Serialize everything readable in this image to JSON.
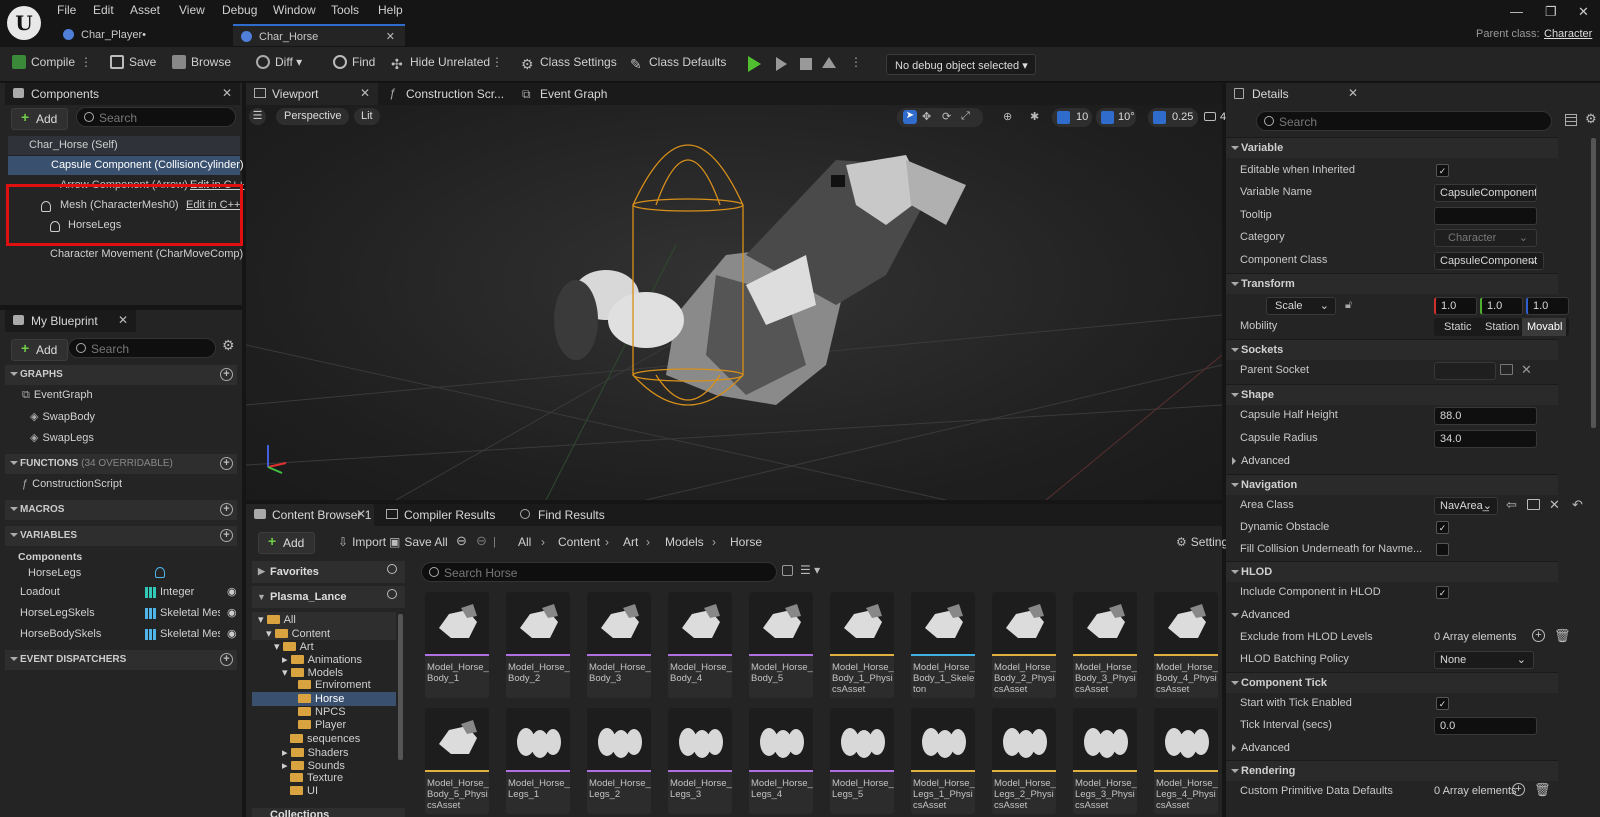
{
  "menu": [
    "File",
    "Edit",
    "Asset",
    "View",
    "Debug",
    "Window",
    "Tools",
    "Help"
  ],
  "tabs": [
    "Char_Player•",
    "Char_Horse"
  ],
  "parent_class": {
    "label": "Parent class:",
    "value": "Character"
  },
  "toolbar": {
    "compile": "Compile",
    "save": "Save",
    "browse": "Browse",
    "diff": "Diff",
    "find": "Find",
    "hide_unrelated": "Hide Unrelated",
    "class_settings": "Class Settings",
    "class_defaults": "Class Defaults",
    "debug": "No debug object selected"
  },
  "components": {
    "title": "Components",
    "add": "Add",
    "search": "Search",
    "items": [
      "Char_Horse (Self)",
      "Capsule Component (CollisionCylinder)",
      "Arrow Component (Arrow)",
      "Edit in C++",
      "Mesh (CharacterMesh0)",
      "Edit in C++",
      "HorseLegs",
      "Character Movement (CharMoveComp)"
    ]
  },
  "my_blueprint": {
    "title": "My Blueprint",
    "add": "Add",
    "search": "Search",
    "graphs": "GRAPHS",
    "event_graph": "EventGraph",
    "swap_body": "SwapBody",
    "swap_legs": "SwapLegs",
    "functions": "FUNCTIONS",
    "functions_count": "(34 OVERRIDABLE)",
    "construction_script": "ConstructionScript",
    "macros": "MACROS",
    "variables": "VARIABLES",
    "components_cat": "Components",
    "vars": [
      {
        "name": "HorseLegs",
        "type": ""
      },
      {
        "name": "Loadout",
        "type": "Integer"
      },
      {
        "name": "HorseLegSkels",
        "type": "Skeletal Mes"
      },
      {
        "name": "HorseBodySkels",
        "type": "Skeletal Mes"
      }
    ],
    "event_dispatchers": "EVENT DISPATCHERS"
  },
  "viewport": {
    "tabs": [
      "Viewport",
      "Construction Scr...",
      "Event Graph"
    ],
    "perspective": "Perspective",
    "lit": "Lit",
    "grid": "10",
    "angle": "10°",
    "scale": "0.25",
    "cam": "4"
  },
  "content": {
    "tabs": [
      "Content Browser 1",
      "Compiler Results",
      "Find Results"
    ],
    "add": "Add",
    "import": "Import",
    "save_all": "Save All",
    "path": [
      "All",
      "Content",
      "Art",
      "Models",
      "Horse"
    ],
    "settings": "Settings",
    "favorites": "Favorites",
    "project": "Plasma_Lance",
    "search": "Search Horse",
    "collections": "Collections",
    "tree": [
      "All",
      "Content",
      "Art",
      "Animations",
      "Models",
      "Enviroment",
      "Horse",
      "NPCS",
      "Player",
      "sequences",
      "Shaders",
      "Sounds",
      "Texture",
      "UI"
    ],
    "assets": [
      "Model_Horse_Body_1",
      "Model_Horse_Body_2",
      "Model_Horse_Body_3",
      "Model_Horse_Body_4",
      "Model_Horse_Body_5",
      "Model_Horse_Body_1_PhysicsAsset",
      "Model_Horse_Body_1_Skeleton",
      "Model_Horse_Body_2_PhysicsAsset",
      "Model_Horse_Body_3_PhysicsAsset",
      "Model_Horse_Body_4_PhysicsAsset",
      "Model_Horse_Body_5_PhysicsAsset",
      "Model_Horse_Legs_1",
      "Model_Horse_Legs_2",
      "Model_Horse_Legs_3",
      "Model_Horse_Legs_4",
      "Model_Horse_Legs_5",
      "Model_Horse_Legs_1_PhysicsAsset",
      "Model_Horse_Legs_2_PhysicsAsset",
      "Model_Horse_Legs_3_PhysicsAsset",
      "Model_Horse_Legs_4_PhysicsAsset"
    ]
  },
  "details": {
    "title": "Details",
    "search": "Search",
    "variable": "Variable",
    "editable": "Editable when Inherited",
    "var_name_l": "Variable Name",
    "var_name": "CapsuleComponent",
    "tooltip": "Tooltip",
    "category_l": "Category",
    "category": "Character",
    "comp_class_l": "Component Class",
    "comp_class": "CapsuleComponent",
    "transform": "Transform",
    "scale": "Scale",
    "sx": "1.0",
    "sy": "1.0",
    "sz": "1.0",
    "mobility": "Mobility",
    "static": "Static",
    "station": "Station",
    "movable": "Movabl",
    "sockets": "Sockets",
    "parent_socket": "Parent Socket",
    "shape": "Shape",
    "half_height_l": "Capsule Half Height",
    "half_height": "88.0",
    "radius_l": "Capsule Radius",
    "radius": "34.0",
    "advanced": "Advanced",
    "navigation": "Navigation",
    "area_class_l": "Area Class",
    "area_class": "NavArea_",
    "dynamic_obstacle": "Dynamic Obstacle",
    "fill_collision": "Fill Collision Underneath for Navme...",
    "hlod": "HLOD",
    "include_hlod": "Include Component in HLOD",
    "exclude_hlod": "Exclude from HLOD Levels",
    "array0": "0 Array elements",
    "hlod_batching": "HLOD Batching Policy",
    "none": "None",
    "component_tick": "Component Tick",
    "start_tick": "Start with Tick Enabled",
    "tick_interval_l": "Tick Interval (secs)",
    "tick_interval": "0.0",
    "rendering": "Rendering",
    "custom_prim": "Custom Primitive Data Defaults"
  }
}
